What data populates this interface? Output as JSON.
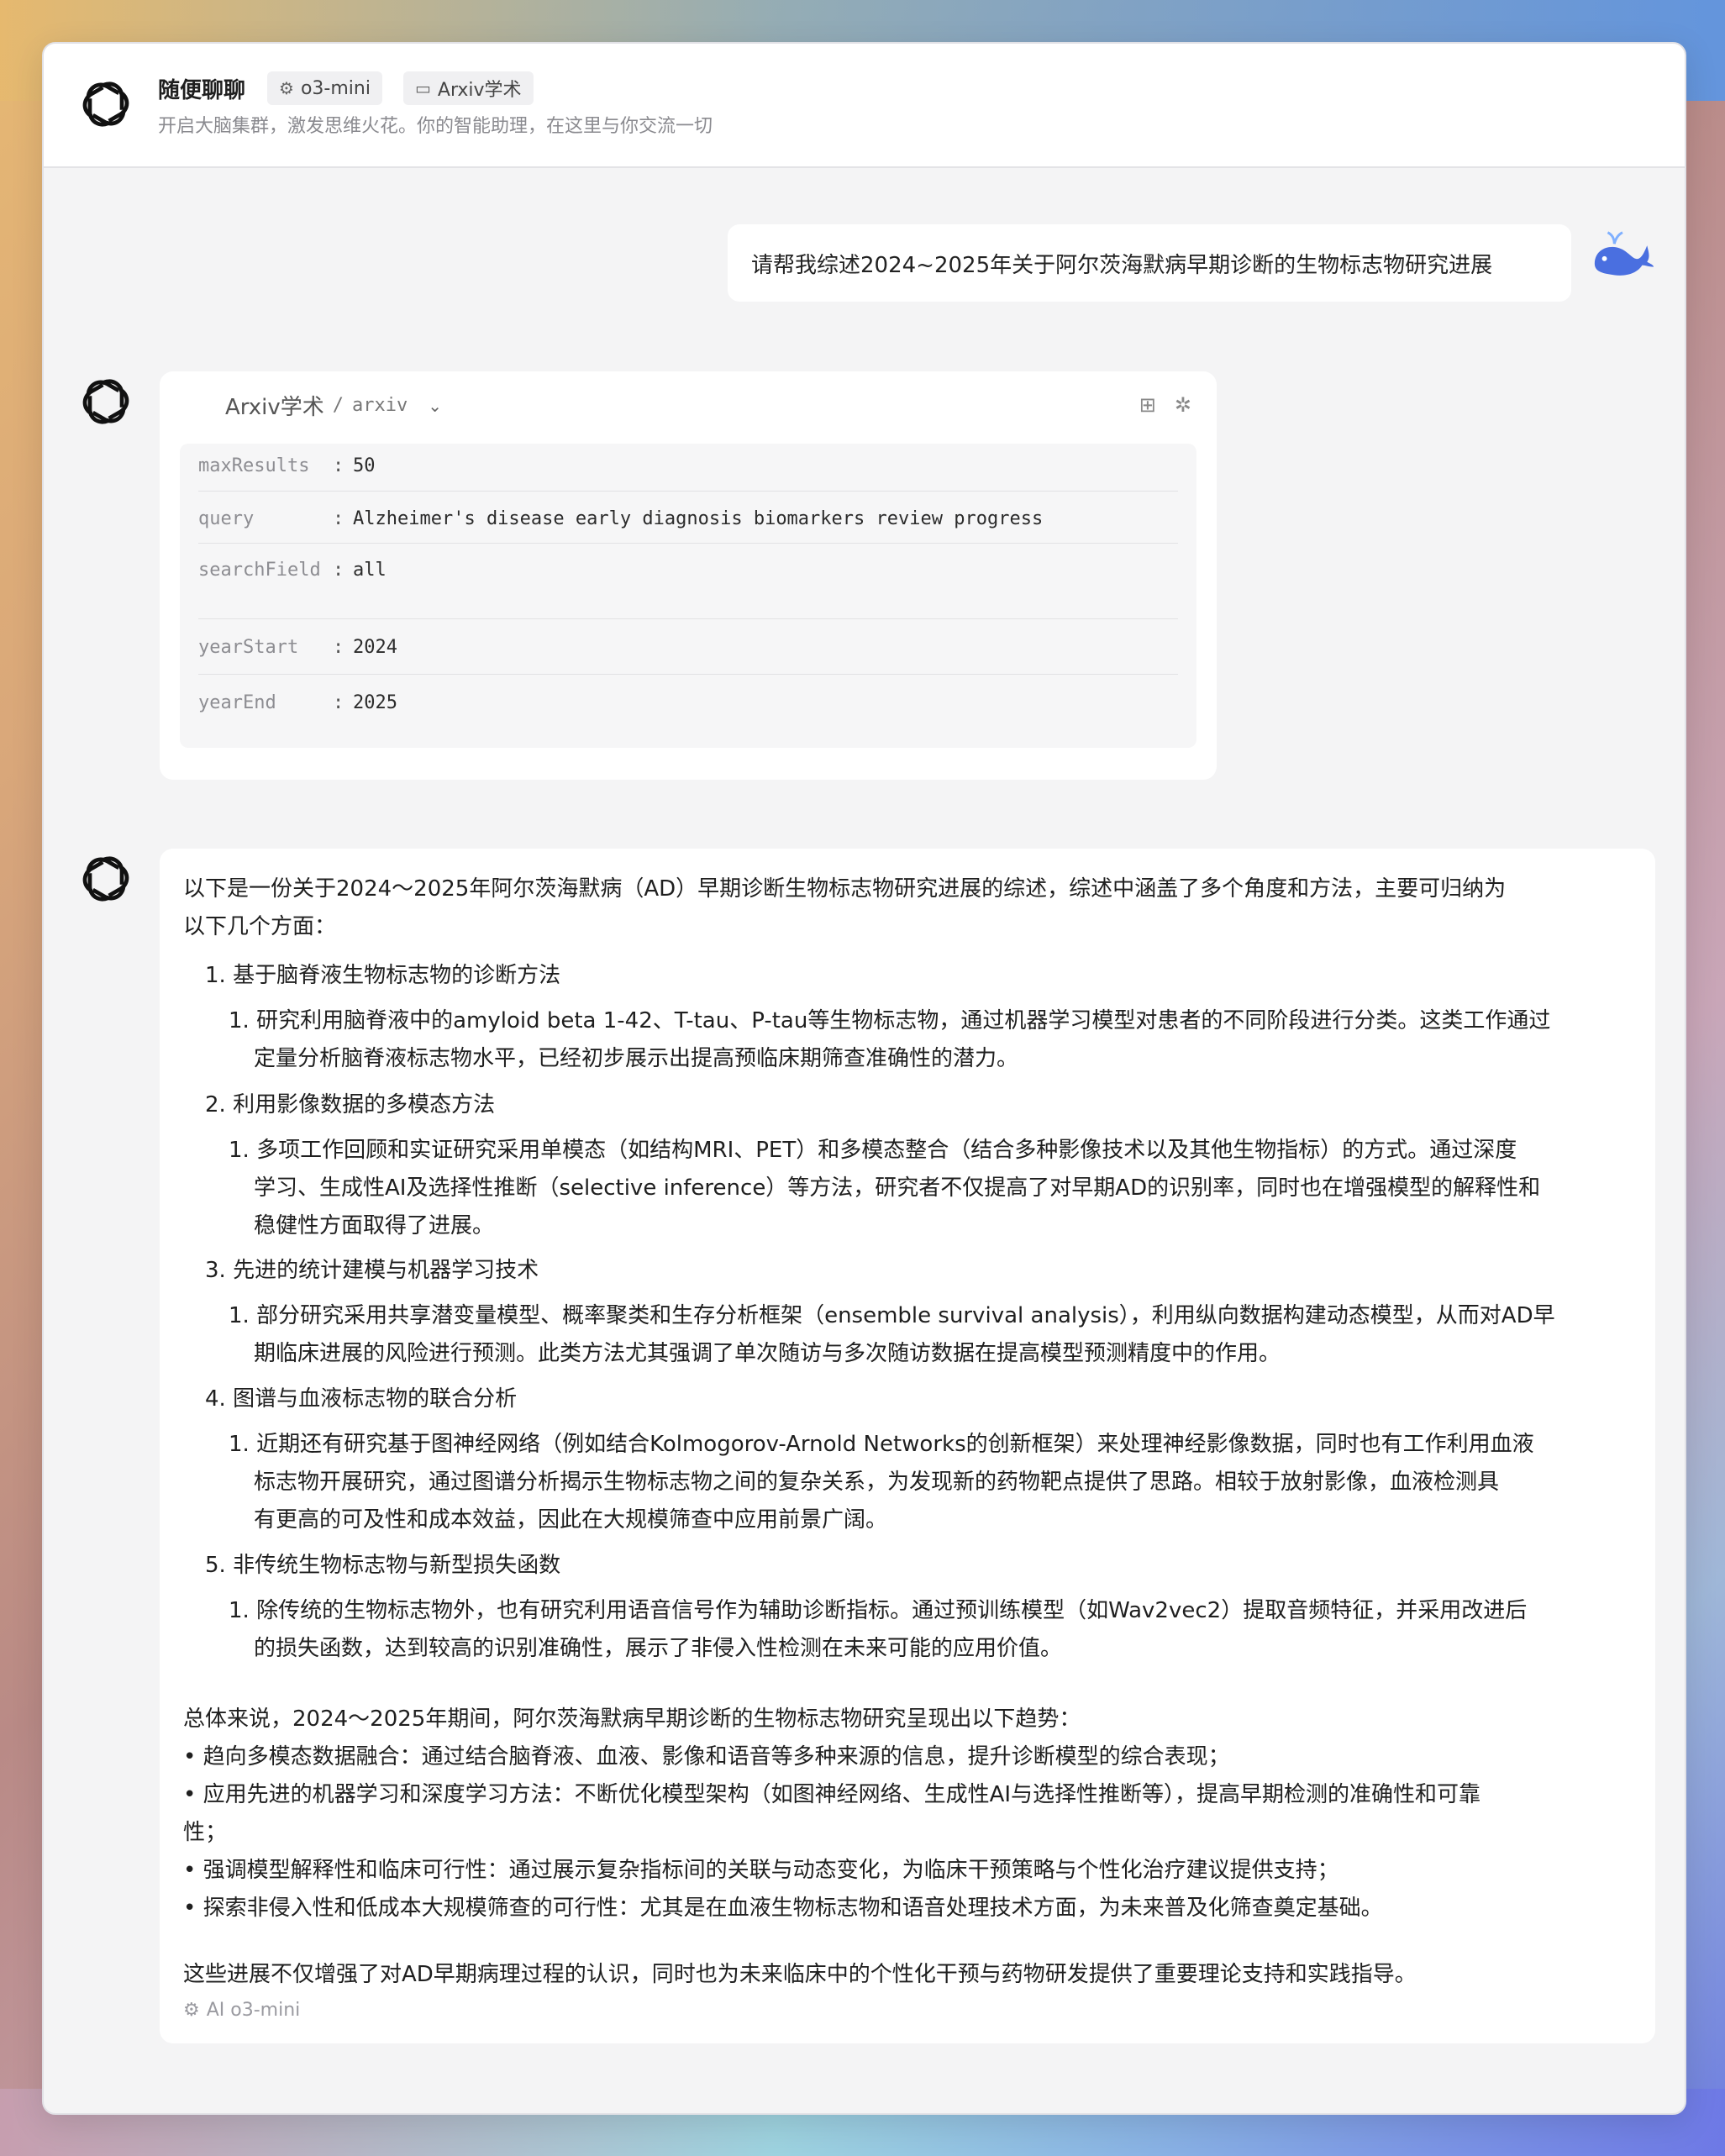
{
  "header": {
    "title": "随便聊聊",
    "model_tag": "o3-mini",
    "plugin_tag": "Arxiv学术",
    "subtitle": "开启大脑集群，激发思维火花。你的智能助理，在这里与你交流一切"
  },
  "user_message": "请帮我综述2024~2025年关于阿尔茨海默病早期诊断的生物标志物研究进展",
  "tool_call": {
    "plugin_name": "Arxiv学术",
    "separator": "/",
    "api_name": "arxiv",
    "params": [
      {
        "key": "maxResults",
        "value": "50"
      },
      {
        "key": "query",
        "value": "Alzheimer's disease early diagnosis biomarkers review progress"
      },
      {
        "key": "searchField",
        "value": "all"
      },
      {
        "key": "yearStart",
        "value": "2024"
      },
      {
        "key": "yearEnd",
        "value": "2025"
      }
    ]
  },
  "answer": {
    "intro_1": "以下是一份关于2024～2025年阿尔茨海默病（AD）早期诊断生物标志物研究进展的综述，综述中涵盖了多个角度和方法，主要可归纳为",
    "intro_2": "以下几个方面：",
    "sections": [
      {
        "title": "1. 基于脑脊液生物标志物的诊断方法",
        "lines": [
          "1. 研究利用脑脊液中的amyloid beta 1-42、T-tau、P-tau等生物标志物，通过机器学习模型对患者的不同阶段进行分类。这类工作通过",
          "定量分析脑脊液标志物水平，已经初步展示出提高预临床期筛查准确性的潜力。"
        ]
      },
      {
        "title": "2. 利用影像数据的多模态方法",
        "lines": [
          "1. 多项工作回顾和实证研究采用单模态（如结构MRI、PET）和多模态整合（结合多种影像技术以及其他生物指标）的方式。通过深度",
          "学习、生成性AI及选择性推断（selective inference）等方法，研究者不仅提高了对早期AD的识别率，同时也在增强模型的解释性和",
          "稳健性方面取得了进展。"
        ]
      },
      {
        "title": "3. 先进的统计建模与机器学习技术",
        "lines": [
          "1. 部分研究采用共享潜变量模型、概率聚类和生存分析框架（ensemble survival analysis），利用纵向数据构建动态模型，从而对AD早",
          "期临床进展的风险进行预测。此类方法尤其强调了单次随访与多次随访数据在提高模型预测精度中的作用。"
        ]
      },
      {
        "title": "4. 图谱与血液标志物的联合分析",
        "lines": [
          "1. 近期还有研究基于图神经网络（例如结合Kolmogorov-Arnold Networks的创新框架）来处理神经影像数据，同时也有工作利用血液",
          "标志物开展研究，通过图谱分析揭示生物标志物之间的复杂关系，为发现新的药物靶点提供了思路。相较于放射影像，血液检测具",
          "有更高的可及性和成本效益，因此在大规模筛查中应用前景广阔。"
        ]
      },
      {
        "title": "5. 非传统生物标志物与新型损失函数",
        "lines": [
          "1. 除传统的生物标志物外，也有研究利用语音信号作为辅助诊断指标。通过预训练模型（如Wav2vec2）提取音频特征，并采用改进后",
          "的损失函数，达到较高的识别准确性，展示了非侵入性检测在未来可能的应用价值。"
        ]
      }
    ],
    "summary_lines": [
      "总体来说，2024～2025年期间，阿尔茨海默病早期诊断的生物标志物研究呈现出以下趋势：",
      "• 趋向多模态数据融合：通过结合脑脊液、血液、影像和语音等多种来源的信息，提升诊断模型的综合表现；",
      "• 应用先进的机器学习和深度学习方法：不断优化模型架构（如图神经网络、生成性AI与选择性推断等），提高早期检测的准确性和可靠",
      "性；",
      "• 强调模型解释性和临床可行性：通过展示复杂指标间的关联与动态变化，为临床干预策略与个性化治疗建议提供支持；",
      "• 探索非侵入性和低成本大规模筛查的可行性：尤其是在血液生物标志物和语音处理技术方面，为未来普及化筛查奠定基础。"
    ],
    "conclusion": "这些进展不仅增强了对AD早期病理过程的认识，同时也为未来临床中的个性化干预与药物研发提供了重要理论支持和实践指导。",
    "footer": "AI o3-mini"
  }
}
